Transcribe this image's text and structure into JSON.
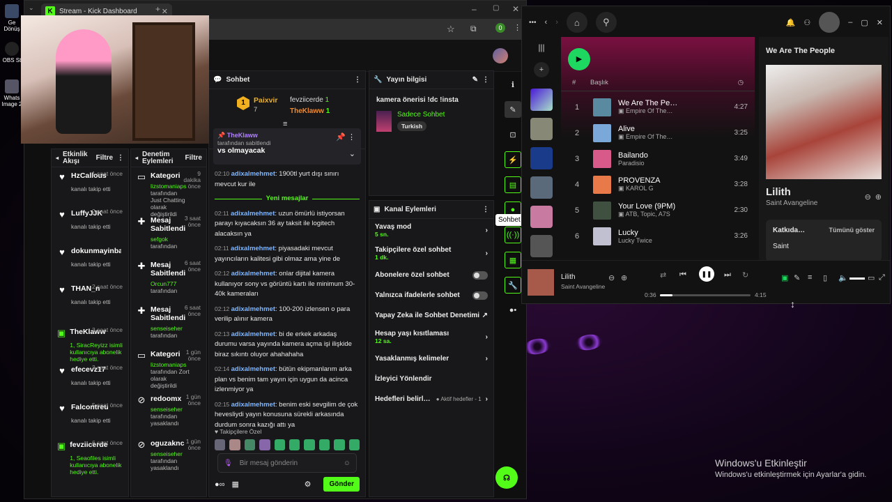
{
  "desktop": {
    "icons": [
      {
        "label": "Ge Dönüş"
      },
      {
        "label": "OBS St"
      },
      {
        "label": "Whats Image 2"
      }
    ],
    "watermark": {
      "title": "Windows'u Etkinleştir",
      "subtitle": "Windows'u etkinleştirmek için Ayarlar'a gidin."
    }
  },
  "browser": {
    "tab_title": "Stream - Kick Dashboard",
    "ext_badge": "0"
  },
  "activity": {
    "title": "Etkinlik Akışı",
    "filter": "Filtre",
    "items": [
      {
        "name": "HzCallous",
        "time": "1 saat önce",
        "desc": "kanalı takip etti",
        "icon": "heart-icon"
      },
      {
        "name": "LuffyJJK",
        "time": "2 saat önce",
        "desc": "kanalı takip etti",
        "icon": "heart-icon"
      },
      {
        "name": "dokunmayinbana",
        "time": "",
        "desc": "kanalı takip etti",
        "icon": "heart-icon"
      },
      {
        "name": "THAN_n",
        "time": "2 saat önce",
        "desc": "kanalı takip etti",
        "icon": "heart-icon"
      },
      {
        "name": "TheKlaww",
        "time": "3 saat önce",
        "desc": "1, SiracReyizz isimli kullanıcıya abonelik hediye etti.",
        "icon": "gift-icon"
      },
      {
        "name": "efecevz17",
        "time": "3 saat önce",
        "desc": "kanalı takip etti",
        "icon": "heart-icon"
      },
      {
        "name": "Falcontreu",
        "time": "5 saat önce",
        "desc": "kanalı takip etti",
        "icon": "heart-icon"
      },
      {
        "name": "fevziicerde",
        "time": "6 saat önce",
        "desc": "1, Seaofiles isimli kullanıcıya abonelik hediye etti.",
        "icon": "gift-icon"
      }
    ]
  },
  "moderation": {
    "title": "Denetim Eylemleri",
    "filter": "Filtre",
    "items": [
      {
        "title": "Kategori",
        "time": "9 dakika önce",
        "who": "lizstomaniaps",
        "desc": "tarafından Just Chatting olarak değiştirildi",
        "icon": "category-icon"
      },
      {
        "title": "Mesaj Sabitlendi",
        "time": "3 saat önce",
        "who": "sefgok",
        "desc": "tarafından",
        "icon": "pin-icon"
      },
      {
        "title": "Mesaj Sabitlendi",
        "time": "6 saat önce",
        "who": "Orcun777",
        "desc": "tarafından",
        "icon": "pin-icon"
      },
      {
        "title": "Mesaj Sabitlendi",
        "time": "6 saat önce",
        "who": "senseiseher",
        "desc": "tarafından",
        "icon": "pin-icon"
      },
      {
        "title": "Kategori",
        "time": "1 gün önce",
        "who": "lizstomaniaps",
        "desc": "tarafından Zort olarak değiştirildi",
        "icon": "category-icon"
      },
      {
        "title": "redoomx",
        "time": "1 gün önce",
        "who": "senseiseher",
        "desc": "tarafından yasaklandı",
        "icon": "ban-icon"
      },
      {
        "title": "oguzaknc",
        "time": "1 gün önce",
        "who": "senseiseher",
        "desc": "tarafından yasaklandı",
        "icon": "ban-icon"
      }
    ]
  },
  "chat": {
    "title": "Sohbet",
    "top1": {
      "name": "Paixvir",
      "count": "7"
    },
    "top2": {
      "name": "fevziicerde",
      "count": "1"
    },
    "top3": {
      "name": "TheKlaww",
      "count": "1"
    },
    "pinned": {
      "user": "TheKlaww",
      "by": "tarafından sabitlendi",
      "text": "vs olmayacak"
    },
    "new_label": "Yeni mesajlar",
    "messages": [
      {
        "time": "02:10",
        "user": "adixalmehmet",
        "text": ": 1900tl yurt dışı sınırı mevcut kur ile"
      },
      {
        "time": "02:11",
        "user": "adixalmehmet",
        "text": ": uzun ömürlü istiyorsan parayı kıyacaksın 36 ay taksit ile logitech alacaksın ya"
      },
      {
        "time": "02:11",
        "user": "adixalmehmet",
        "text": ": piyasadaki mevcut yayıncıların kalitesi gibi olmaz ama yine de"
      },
      {
        "time": "02:12",
        "user": "adixalmehmet",
        "text": ": onlar dijital kamera kullanıyor sony vs görüntü kartı ile minimum 30-40k kameraları"
      },
      {
        "time": "02:12",
        "user": "adixalmehmet",
        "text": ": 100-200 izlensen o para verilip alınır kamera"
      },
      {
        "time": "02:13",
        "user": "adixalmehmet",
        "text": ": bi de erkek arkadaş durumu varsa yayında kamera açma işi ilişkide biraz sıkıntı oluyor ahahahaha"
      },
      {
        "time": "02:14",
        "user": "adixalmehmet",
        "text": ": bütün ekipmanlarım arka plan vs benim tam yayın için uygun da acinca izlenmiyor ya"
      },
      {
        "time": "02:15",
        "user": "adixalmehmet",
        "text": ": benim eski sevgilim de çok hevesliydi yayın konusuna sürekli arkasında durdum sonra kazığı attı ya"
      }
    ],
    "followers_label": "Takipçilere Özel",
    "placeholder": "Bir mesaj gönderin",
    "send": "Gönder"
  },
  "stream_info": {
    "title": "Yayın bilgisi",
    "stream_title": "kamera önerisi !dc !insta",
    "category": "Sadece Sohbet",
    "tag": "Turkish"
  },
  "channel_actions": {
    "title": "Kanal Eylemleri",
    "items": [
      {
        "label": "Yavaş mod",
        "sub": "5 sn.",
        "ctrl": "chevron"
      },
      {
        "label": "Takipçilere özel sohbet",
        "sub": "1 dk.",
        "ctrl": "chevron"
      },
      {
        "label": "Abonelere özel sohbet",
        "sub": "",
        "ctrl": "toggle"
      },
      {
        "label": "Yalnızca ifadelerle sohbet",
        "sub": "",
        "ctrl": "toggle"
      },
      {
        "label": "Yapay Zeka ile Sohbet Denetimi",
        "sub": "",
        "ctrl": "external"
      },
      {
        "label": "Hesap yaşı kısıtlaması",
        "sub": "12 sa.",
        "ctrl": "chevron"
      },
      {
        "label": "Yasaklanmış kelimeler",
        "sub": "",
        "ctrl": "chevron"
      },
      {
        "label": "İzleyici Yönlendir",
        "sub": "",
        "ctrl": ""
      },
      {
        "label": "Hedefleri belirl…",
        "sub": "",
        "ctrl": "goals"
      }
    ],
    "goals_status": "Aktif hedefler - 1",
    "tooltip": "Sohbet"
  },
  "spotify": {
    "header_col": "Başlık",
    "tracks": [
      {
        "n": "1",
        "title": "We Are The Pe…",
        "artist": "Empire Of The…",
        "dur": "4:27",
        "explicit": true,
        "color": "#5a8aa0"
      },
      {
        "n": "2",
        "title": "Alive",
        "artist": "Empire Of The…",
        "dur": "3:25",
        "explicit": true,
        "color": "#7aa8d8"
      },
      {
        "n": "3",
        "title": "Bailando",
        "artist": "Paradisio",
        "dur": "3:49",
        "explicit": false,
        "color": "#d85a8a"
      },
      {
        "n": "4",
        "title": "PROVENZA",
        "artist": "KAROL G",
        "dur": "3:28",
        "explicit": true,
        "color": "#e87a4a"
      },
      {
        "n": "5",
        "title": "Your Love (9PM)",
        "artist": "ATB, Topic, A7S",
        "dur": "2:30",
        "explicit": true,
        "color": "#405040"
      },
      {
        "n": "6",
        "title": "Lucky",
        "artist": "Lucky Twice",
        "dur": "3:26",
        "explicit": false,
        "color": "#c0c0d0"
      }
    ],
    "npv": {
      "playlist": "We Are The People",
      "song": "Lilith",
      "artist": "Saint Avangeline",
      "credits": "Katkıda…",
      "show_all": "Tümünü göster",
      "credit_name": "Saint"
    },
    "player": {
      "song": "Lilith",
      "artist": "Saint Avangeline",
      "elapsed": "0:36",
      "total": "4:15",
      "progress": 0.14
    }
  }
}
